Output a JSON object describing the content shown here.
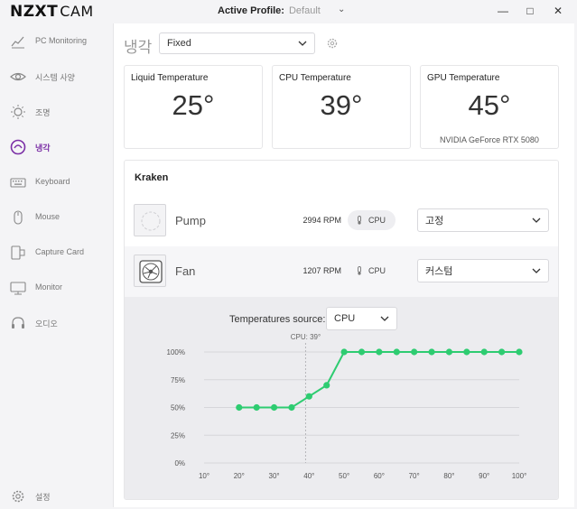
{
  "app": {
    "logo": "NZXT",
    "logo_suffix": "CAM",
    "profile_label": "Active Profile:",
    "profile_value": "Default"
  },
  "sidebar": {
    "items": [
      {
        "label": "PC Monitoring",
        "icon": "monitoring-icon",
        "active": false
      },
      {
        "label": "시스템 사양",
        "icon": "eye-icon",
        "active": false
      },
      {
        "label": "조명",
        "icon": "sun-icon",
        "active": false
      },
      {
        "label": "냉각",
        "icon": "cooling-icon",
        "active": true
      },
      {
        "label": "Keyboard",
        "icon": "keyboard-icon",
        "active": false
      },
      {
        "label": "Mouse",
        "icon": "mouse-icon",
        "active": false
      },
      {
        "label": "Capture Card",
        "icon": "capture-card-icon",
        "active": false
      },
      {
        "label": "Monitor",
        "icon": "monitor-icon",
        "active": false
      },
      {
        "label": "오디오",
        "icon": "headset-icon",
        "active": false
      }
    ],
    "settings_label": "설정"
  },
  "main": {
    "title": "냉각",
    "mode_value": "Fixed",
    "temps": [
      {
        "title": "Liquid Temperature",
        "value": "25°",
        "sub": ""
      },
      {
        "title": "CPU Temperature",
        "value": "39°",
        "sub": ""
      },
      {
        "title": "GPU Temperature",
        "value": "45°",
        "sub": "NVIDIA GeForce RTX 5080"
      }
    ],
    "kraken": {
      "title": "Kraken",
      "devices": [
        {
          "name": "Pump",
          "rpm": "2994 RPM",
          "source": "CPU",
          "mode": "고정"
        },
        {
          "name": "Fan",
          "rpm": "1207 RPM",
          "source": "CPU",
          "mode": "커스텀"
        }
      ],
      "temp_source_label": "Temperatures source:",
      "temp_source_value": "CPU"
    }
  },
  "colors": {
    "accent": "#7b2fa6",
    "curve": "#2ecc71"
  },
  "chart_data": {
    "type": "line",
    "x": [
      20,
      25,
      30,
      35,
      40,
      45,
      50,
      55,
      60,
      65,
      70,
      75,
      80,
      85,
      90,
      95,
      100
    ],
    "series": [
      {
        "values": [
          50,
          50,
          50,
          50,
          60,
          70,
          100,
          100,
          100,
          100,
          100,
          100,
          100,
          100,
          100,
          100,
          100
        ]
      }
    ],
    "x_ticks": [
      "10°",
      "20°",
      "30°",
      "40°",
      "50°",
      "60°",
      "70°",
      "80°",
      "90°",
      "100°"
    ],
    "y_ticks": [
      "0%",
      "25%",
      "50%",
      "75%",
      "100%"
    ],
    "xlim": [
      10,
      100
    ],
    "ylim": [
      0,
      100
    ],
    "marker": {
      "label": "CPU: 39°",
      "x": 39
    },
    "grid": true
  }
}
